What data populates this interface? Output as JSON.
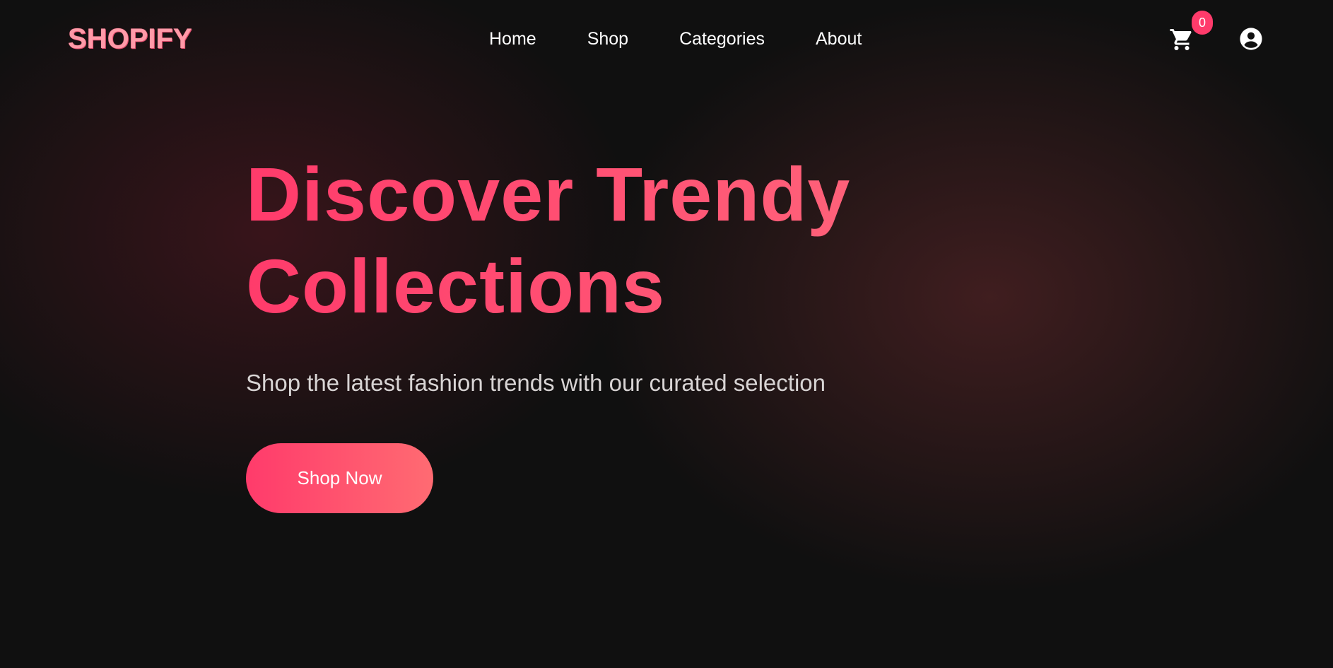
{
  "brand": {
    "name": "SHOPIFY",
    "color": "#ff9aa8"
  },
  "nav": {
    "links": [
      {
        "label": "Home"
      },
      {
        "label": "Shop"
      },
      {
        "label": "Categories"
      },
      {
        "label": "About"
      }
    ]
  },
  "header_actions": {
    "cart_icon": "shopping-cart-icon",
    "cart_count": "0",
    "account_icon": "user-circle-icon"
  },
  "hero": {
    "title_line1": "Discover Trendy",
    "title_line2": "Collections",
    "subtitle": "Shop the latest fashion trends with our curated selection",
    "cta_label": "Shop Now"
  },
  "colors": {
    "background": "#101010",
    "accent": "#ff3b6b",
    "accent_end": "#ff6b72",
    "text": "#ffffff",
    "subtitle": "#d8d4d4"
  }
}
